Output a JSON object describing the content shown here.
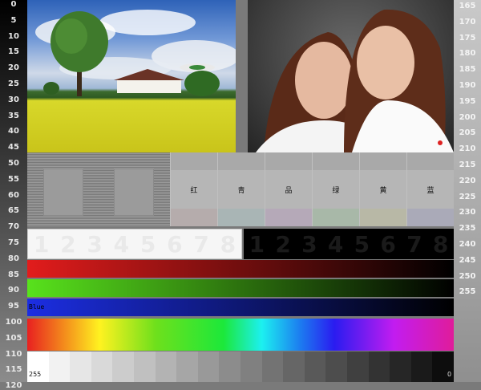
{
  "scale_left": [
    "0",
    "5",
    "10",
    "15",
    "20",
    "25",
    "30",
    "35",
    "40",
    "45",
    "50",
    "55",
    "60",
    "65",
    "70",
    "75",
    "80",
    "85",
    "90",
    "95",
    "100",
    "105",
    "110",
    "115",
    "120"
  ],
  "scale_right": [
    "165",
    "170",
    "175",
    "180",
    "185",
    "190",
    "195",
    "200",
    "205",
    "210",
    "215",
    "220",
    "225",
    "230",
    "235",
    "240",
    "245",
    "250",
    "255"
  ],
  "color_labels": [
    "红",
    "青",
    "品",
    "绿",
    "黄",
    "蓝"
  ],
  "color_bottoms": [
    "#b5acac",
    "#a9b5b5",
    "#b5a9b8",
    "#a8b8a8",
    "#b8b8a6",
    "#aaaab8"
  ],
  "white_numbers": [
    "1",
    "2",
    "3",
    "4",
    "5",
    "6",
    "7",
    "8"
  ],
  "black_numbers": [
    "1",
    "2",
    "3",
    "4",
    "5",
    "6",
    "7",
    "8"
  ],
  "blue_label": "Blue",
  "greyscale_left": "255",
  "greyscale_right": "0",
  "greyscale_steps": [
    "#ffffff",
    "#f2f2f2",
    "#e6e6e6",
    "#d9d9d9",
    "#cccccc",
    "#c0c0c0",
    "#b3b3b3",
    "#a6a6a6",
    "#999999",
    "#8c8c8c",
    "#808080",
    "#737373",
    "#666666",
    "#595959",
    "#4d4d4d",
    "#404040",
    "#333333",
    "#262626",
    "#1a1a1a",
    "#0d0d0d"
  ]
}
